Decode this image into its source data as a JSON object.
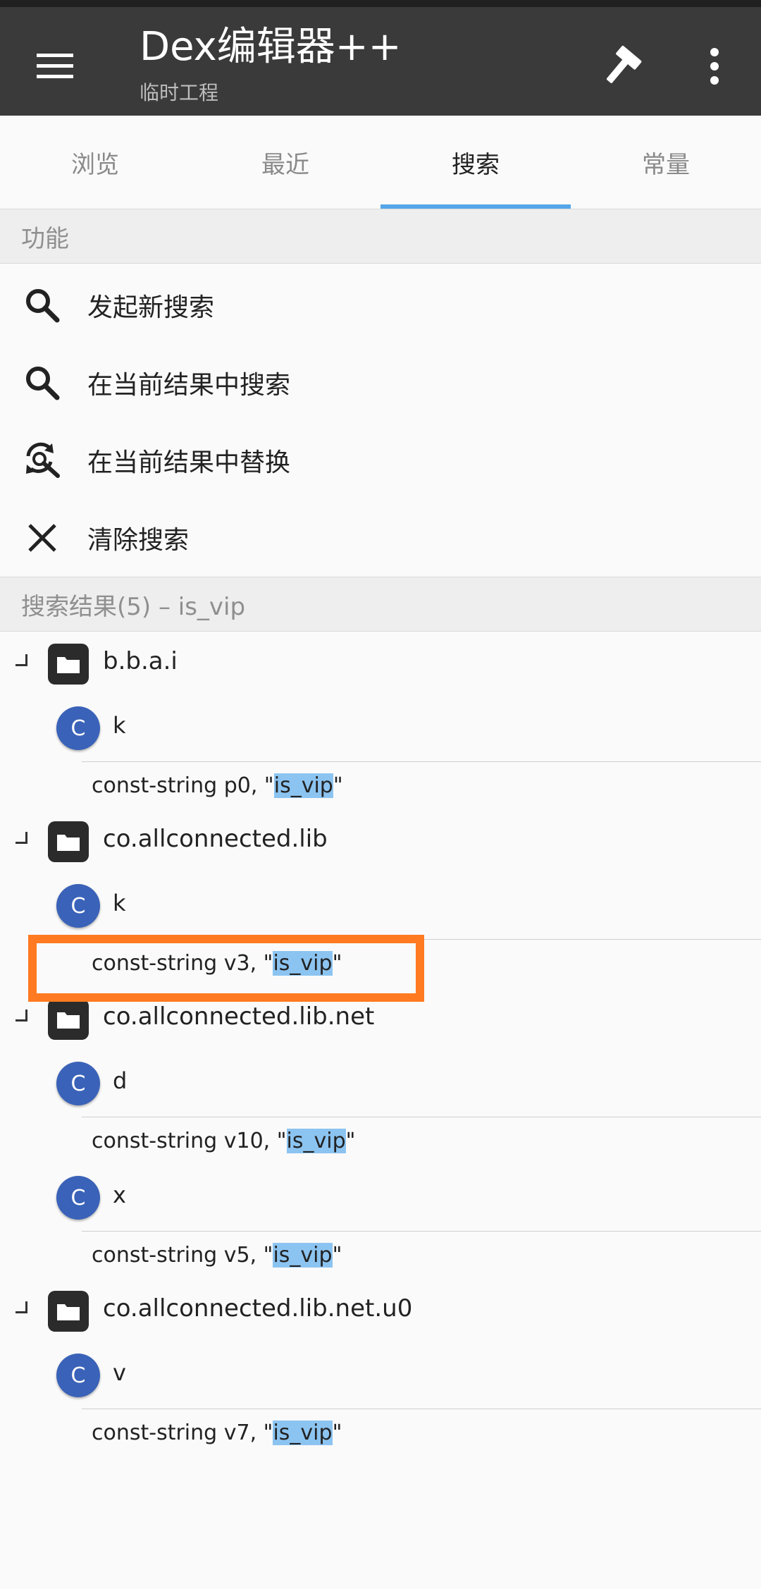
{
  "app": {
    "title": "Dex编辑器++",
    "subtitle": "临时工程"
  },
  "tabs": [
    {
      "label": "浏览",
      "active": false
    },
    {
      "label": "最近",
      "active": false
    },
    {
      "label": "搜索",
      "active": true
    },
    {
      "label": "常量",
      "active": false
    }
  ],
  "functions": {
    "header": "功能",
    "items": [
      {
        "label": "发起新搜索",
        "icon": "search-icon"
      },
      {
        "label": "在当前结果中搜索",
        "icon": "search-icon"
      },
      {
        "label": "在当前结果中替换",
        "icon": "search-replace-icon"
      },
      {
        "label": "清除搜索",
        "icon": "close-icon"
      }
    ]
  },
  "results": {
    "header": "搜索结果(5) – is_vip",
    "packages": [
      {
        "name": "b.b.a.i",
        "classes": [
          {
            "name": "k",
            "code_prefix": "const-string p0, \"",
            "match": "is_vip",
            "code_suffix": "\""
          }
        ]
      },
      {
        "name": "co.allconnected.lib",
        "classes": [
          {
            "name": "k",
            "code_prefix": "const-string v3, \"",
            "match": "is_vip",
            "code_suffix": "\""
          }
        ]
      },
      {
        "name": "co.allconnected.lib.net",
        "classes": [
          {
            "name": "d",
            "code_prefix": "const-string v10, \"",
            "match": "is_vip",
            "code_suffix": "\""
          },
          {
            "name": "x",
            "code_prefix": "const-string v5, \"",
            "match": "is_vip",
            "code_suffix": "\""
          }
        ]
      },
      {
        "name": "co.allconnected.lib.net.u0",
        "classes": [
          {
            "name": "v",
            "code_prefix": "const-string v7, \"",
            "match": "is_vip",
            "code_suffix": "\""
          }
        ]
      }
    ],
    "class_badge": "C"
  },
  "colors": {
    "appbar": "#3a3a3a",
    "tab_indicator": "#55a6e8",
    "match_highlight": "#8cc4f1",
    "class_badge": "#3a62b8",
    "annotation_box": "#ff7a21"
  }
}
